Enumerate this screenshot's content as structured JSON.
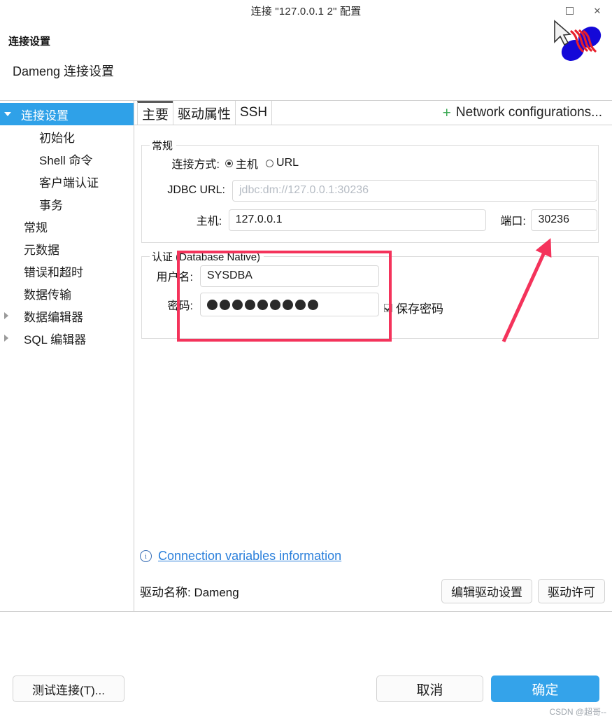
{
  "window": {
    "title": "连接 \"127.0.0.1 2\" 配置",
    "maximize_label": "□",
    "close_label": "✕"
  },
  "header": {
    "title": "连接设置",
    "subtitle": "Dameng 连接设置"
  },
  "sidebar": {
    "items": [
      {
        "label": "连接设置",
        "indent": 30,
        "selected": true,
        "arrow": "down"
      },
      {
        "label": "初始化",
        "indent": 56,
        "selected": false,
        "arrow": "none"
      },
      {
        "label": "Shell 命令",
        "indent": 56,
        "selected": false,
        "arrow": "none"
      },
      {
        "label": "客户端认证",
        "indent": 56,
        "selected": false,
        "arrow": "none"
      },
      {
        "label": "事务",
        "indent": 56,
        "selected": false,
        "arrow": "none"
      },
      {
        "label": "常规",
        "indent": 34,
        "selected": false,
        "arrow": "none"
      },
      {
        "label": "元数据",
        "indent": 34,
        "selected": false,
        "arrow": "none"
      },
      {
        "label": "错误和超时",
        "indent": 34,
        "selected": false,
        "arrow": "none"
      },
      {
        "label": "数据传输",
        "indent": 34,
        "selected": false,
        "arrow": "none"
      },
      {
        "label": "数据编辑器",
        "indent": 34,
        "selected": false,
        "arrow": "right"
      },
      {
        "label": "SQL 编辑器",
        "indent": 34,
        "selected": false,
        "arrow": "right"
      }
    ]
  },
  "tabs": [
    {
      "label": "主要",
      "active": true
    },
    {
      "label": "驱动属性",
      "active": false
    },
    {
      "label": "SSH",
      "active": false
    }
  ],
  "network_configurations": {
    "plus": "+",
    "label": "Network configurations..."
  },
  "general_group": {
    "title": "常规",
    "conn_method_label": "连接方式:",
    "radio_host": "主机",
    "radio_url": "URL",
    "radio_selected": "主机",
    "jdbc_label": "JDBC URL:",
    "jdbc_placeholder": "jdbc:dm://127.0.0.1:30236",
    "jdbc_value": "",
    "host_label": "主机:",
    "host_value": "127.0.0.1",
    "port_label": "端口:",
    "port_value": "30236"
  },
  "auth_group": {
    "title": "认证 (Database Native)",
    "user_label": "用户名:",
    "user_value": "SYSDBA",
    "password_label": "密码:",
    "password_mask": "●●●●●●●●●",
    "password_dot_count": 9,
    "save_password_label": "保存密码",
    "save_password_checked": true
  },
  "footer": {
    "connection_variables_link": "Connection variables information",
    "info_icon_glyph": "i",
    "driver_name_label": "驱动名称: Dameng",
    "edit_driver_button": "编辑驱动设置",
    "driver_license_button": "驱动许可"
  },
  "dialog_buttons": {
    "test_connection": "测试连接(T)...",
    "cancel": "取消",
    "ok": "确定"
  },
  "watermark": "CSDN @超哥--",
  "colors": {
    "accent_blue": "#34a3ea",
    "sidebar_selected": "#2fa1e8",
    "link_blue": "#2a7fdb",
    "annotation_red": "#f4335b",
    "plus_green": "#3aa853"
  }
}
